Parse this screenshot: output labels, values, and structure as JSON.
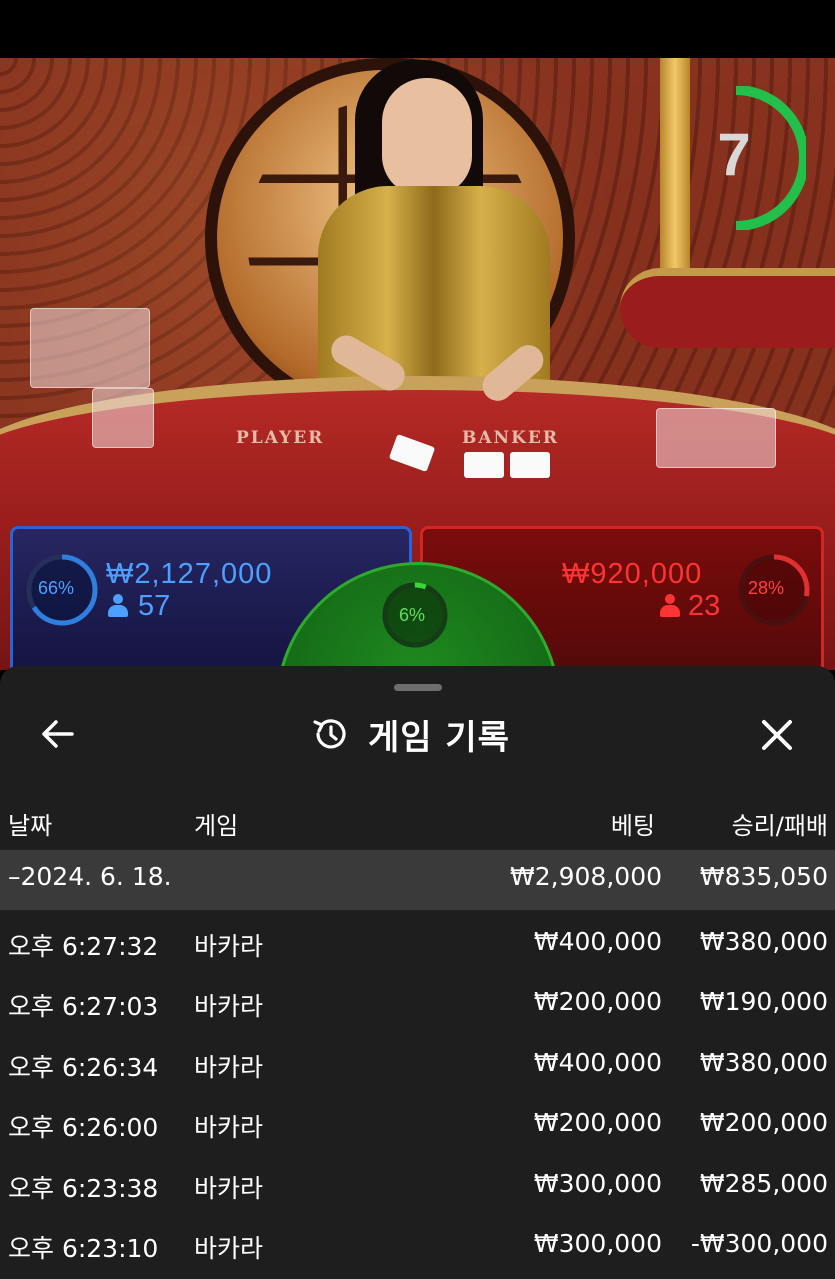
{
  "timer": {
    "value": "7",
    "fraction_remaining": 0.5
  },
  "table_labels": {
    "player": "PLAYER",
    "banker": "BANKER"
  },
  "bets": {
    "player": {
      "percent": "66%",
      "amount": "₩2,127,000",
      "count": "57",
      "color": "#2b64d6"
    },
    "tie": {
      "percent": "6%",
      "color": "#2eaa2e"
    },
    "banker": {
      "percent": "28%",
      "amount": "₩920,000",
      "count": "23",
      "color": "#d42424"
    }
  },
  "panel": {
    "title": "게임 기록",
    "icons": {
      "back": "arrow-left-icon",
      "history": "history-icon",
      "close": "close-icon"
    },
    "columns": {
      "date": "날짜",
      "game": "게임",
      "bet": "베팅",
      "result": "승리/패배"
    },
    "date_row": {
      "label": "–2024. 6. 18.",
      "bet": "₩2,908,000",
      "result": "₩835,050"
    },
    "rows": [
      {
        "time": "오후 6:27:32",
        "game": "바카라",
        "bet": "₩400,000",
        "result": "₩380,000"
      },
      {
        "time": "오후 6:27:03",
        "game": "바카라",
        "bet": "₩200,000",
        "result": "₩190,000"
      },
      {
        "time": "오후 6:26:34",
        "game": "바카라",
        "bet": "₩400,000",
        "result": "₩380,000"
      },
      {
        "time": "오후 6:26:00",
        "game": "바카라",
        "bet": "₩200,000",
        "result": "₩200,000"
      },
      {
        "time": "오후 6:23:38",
        "game": "바카라",
        "bet": "₩300,000",
        "result": "₩285,000"
      },
      {
        "time": "오후 6:23:10",
        "game": "바카라",
        "bet": "₩300,000",
        "result": "-₩300,000"
      }
    ]
  }
}
